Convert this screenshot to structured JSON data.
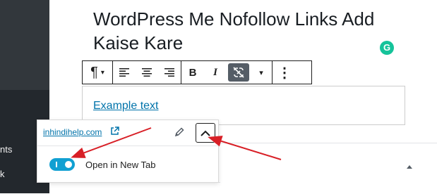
{
  "sidebar": {
    "items": [
      {
        "label": "nts"
      },
      {
        "label": "k"
      }
    ]
  },
  "post": {
    "title": "WordPress Me Nofollow Links Add Kaise Kare",
    "paragraph_link_text": "Example text"
  },
  "grammarly": {
    "letter": "G"
  },
  "toolbar": {
    "paragraph_icon": "¶",
    "dropdown_icon": "▾",
    "bold_label": "B",
    "italic_label": "I",
    "more_icon": "⋮",
    "icons": [
      "paragraph-icon",
      "align-left-icon",
      "align-center-icon",
      "align-right-icon",
      "unlink-icon",
      "more-options-icon"
    ]
  },
  "link_popover": {
    "url": "inhindihelp.com",
    "open_in_new_tab_label": "Open in New Tab",
    "open_in_new_tab_on": true
  },
  "colors": {
    "link": "#0073aa",
    "toggle_on": "#11a0d2",
    "annotation_arrow": "#d81f26",
    "sidebar": "#23282d"
  }
}
